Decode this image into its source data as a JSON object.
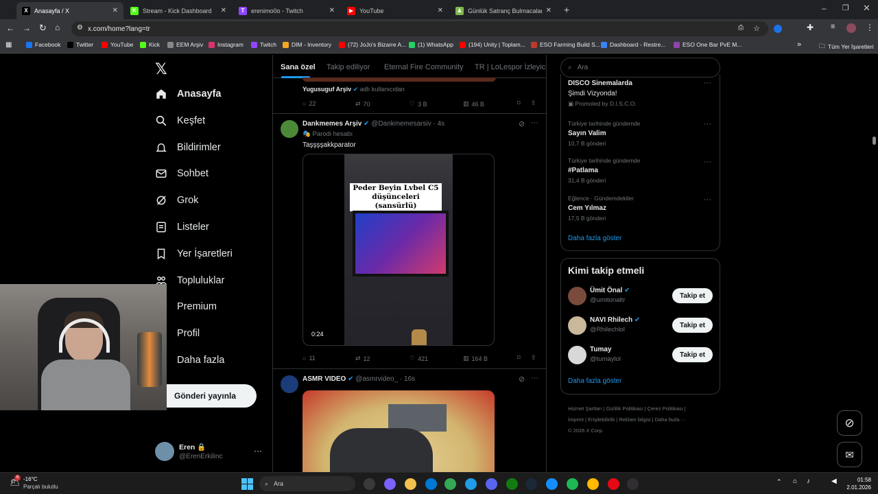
{
  "browser": {
    "tabs": [
      {
        "label": "Anasayfa / X",
        "color": "#000000",
        "glyph": "X"
      },
      {
        "label": "Stream - Kick Dashboard",
        "color": "#53fc18",
        "glyph": "K"
      },
      {
        "label": "erenimo0o - Twitch",
        "color": "#9146ff",
        "glyph": "T"
      },
      {
        "label": "YouTube",
        "color": "#ff0000",
        "glyph": "▶"
      },
      {
        "label": "Günlük Satranç Bulmacaları - G",
        "color": "#81b64c",
        "glyph": "♟"
      }
    ],
    "url": "x.com/home?lang=tr",
    "bookmarks": [
      {
        "label": "Facebook",
        "color": "#1877f2"
      },
      {
        "label": "Twitter",
        "color": "#000000"
      },
      {
        "label": "YouTube",
        "color": "#ff0000"
      },
      {
        "label": "Kick",
        "color": "#53fc18"
      },
      {
        "label": "EEM Arşiv",
        "color": "#888888"
      },
      {
        "label": "Instagram",
        "color": "#e1306c"
      },
      {
        "label": "Twitch",
        "color": "#9146ff"
      },
      {
        "label": "DIM - Inventory",
        "color": "#f5a623"
      },
      {
        "label": "(72) JoJo's Bizarre A...",
        "color": "#ff0000"
      },
      {
        "label": "(1) WhatsApp",
        "color": "#25d366"
      },
      {
        "label": "(194) Unity | Toplam...",
        "color": "#ff0000"
      },
      {
        "label": "ESO Farming Build S...",
        "color": "#c0392b"
      },
      {
        "label": "Dashboard - Restre...",
        "color": "#3b82f6"
      },
      {
        "label": "ESO One Bar PvE M...",
        "color": "#8e44ad"
      }
    ],
    "all_bookmarks": "Tüm Yer İşaretleri"
  },
  "nav": {
    "items": [
      "Anasayfa",
      "Keşfet",
      "Bildirimler",
      "Sohbet",
      "Grok",
      "Listeler",
      "Yer İşaretleri",
      "Topluluklar",
      "Premium",
      "Profil",
      "Daha fazla"
    ],
    "post_button": "Gönderi yayınla",
    "user_name": "Eren",
    "user_handle": "@ErenErkilinc"
  },
  "feed_tabs": [
    "Sana özel",
    "Takip ediliyor",
    "Eternal Fire Community",
    "TR | LoLespor İzleyicile"
  ],
  "posts": [
    {
      "author": "Yugusuguf Arşiv",
      "badge": "adlı kullanıcıdan",
      "replies": "22",
      "retweets": "70",
      "likes": "3 B",
      "views": "46 B"
    },
    {
      "author": "Dankmemes Arşiv",
      "handle": "@Dankmemesarsiv",
      "time": "· 4s",
      "label": "Parodi hesabı",
      "text": "Taşşşşakkparator",
      "video_caption": "Peder Beyin Lvbel C5 düşünceleri (sansürlü)",
      "duration": "0:24",
      "replies": "11",
      "retweets": "12",
      "likes": "421",
      "views": "164 B"
    },
    {
      "author": "ASMR VIDEO",
      "handle": "@asmrvideo_",
      "time": "· 16s"
    }
  ],
  "search_placeholder": "Ara",
  "trends": [
    {
      "title": "DISCO Sinemalarda",
      "sub": "Şimdi Vizyonda!",
      "meta": "Promoted by D.I.S.C.O."
    },
    {
      "context": "Türkiye tarihinde gündemde",
      "title": "Sayın Valim",
      "meta": "10,7 B gönderi"
    },
    {
      "context": "Türkiye tarihinde gündemde",
      "title": "#Patlama",
      "meta": "31,4 B gönderi"
    },
    {
      "context": "Eğlence · Gündemdekiler",
      "title": "Cem Yılmaz",
      "meta": "17,5 B gönderi"
    }
  ],
  "show_more": "Daha fazla göster",
  "who_to_follow": {
    "title": "Kimi takip etmeli",
    "users": [
      {
        "name": "Ümit Önal",
        "handle": "@umitonaltr",
        "button": "Takip et"
      },
      {
        "name": "NAVI Rhilech",
        "handle": "@Rhilechlol",
        "button": "Takip et"
      },
      {
        "name": "Tumay",
        "handle": "@tumaylol",
        "button": "Takip et"
      }
    ],
    "show_more": "Daha fazla göster"
  },
  "footer": {
    "line1": "Hizmet Şartları | Gizlilik Politikası | Çerez Politikası |",
    "line2": "İmprint | Erişilebilirlik | Reklam bilgisi | Daha fazla ···",
    "line3": "© 2026 X Corp."
  },
  "taskbar": {
    "weather_temp": "-16°C",
    "weather_desc": "Parçalı bulutlu",
    "weather_badge": "6",
    "search": "Ara",
    "time": "01:58",
    "date": "2.01.2026"
  }
}
